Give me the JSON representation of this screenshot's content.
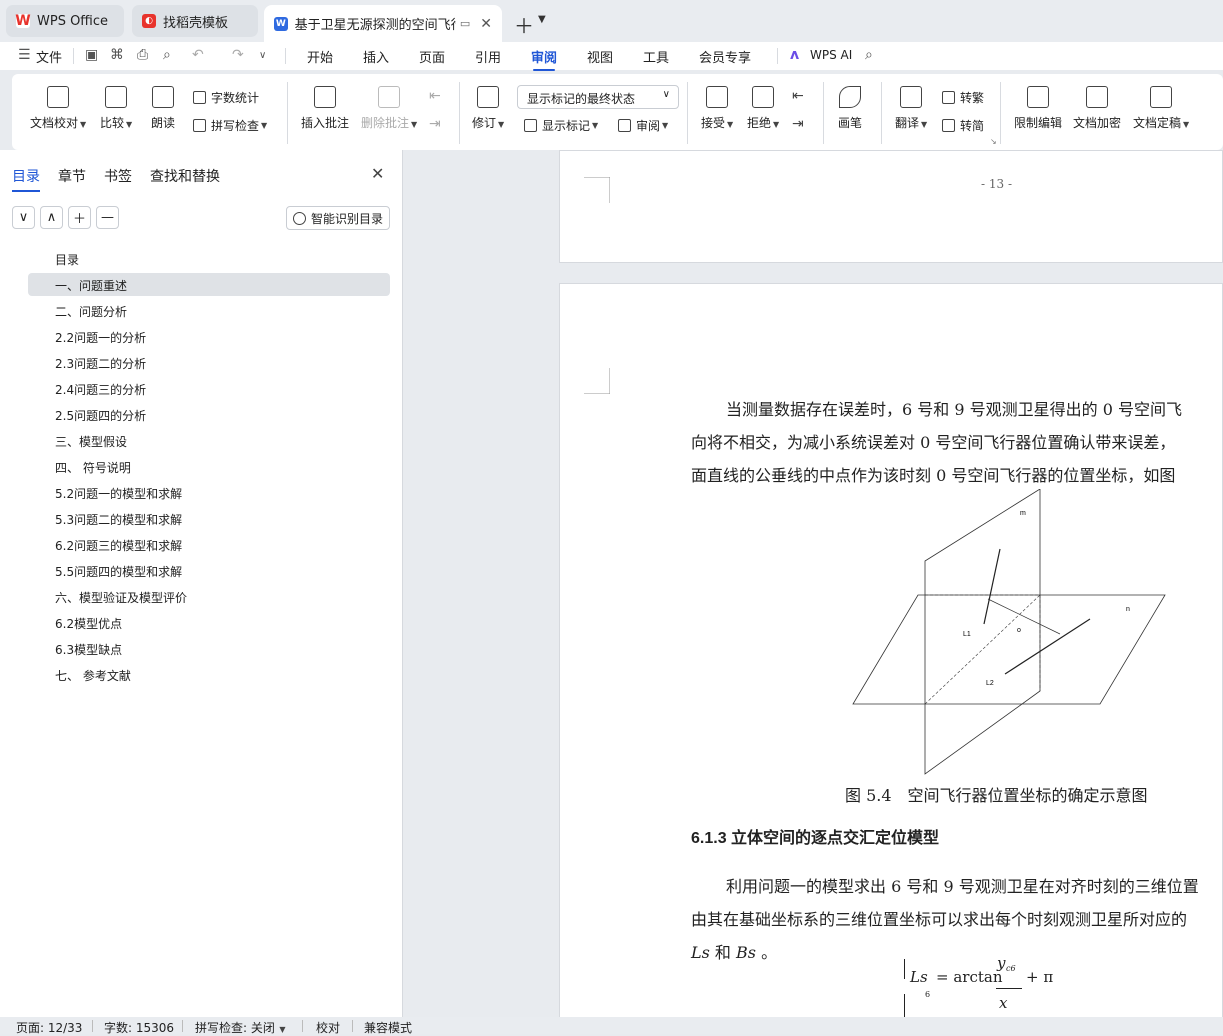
{
  "tabs": [
    {
      "label": "WPS Office",
      "icon": "wps-logo-icon"
    },
    {
      "label": "找稻壳模板",
      "icon": "docer-icon"
    },
    {
      "label": "基于卫星无源探测的空间飞行器",
      "icon": "word-doc-icon"
    }
  ],
  "menu": {
    "file": "文件",
    "items": [
      "开始",
      "插入",
      "页面",
      "引用",
      "审阅",
      "视图",
      "工具",
      "会员专享"
    ],
    "active": "审阅",
    "ai": "WPS AI"
  },
  "ribbon": {
    "doc_proof": "文档校对",
    "compare": "比较",
    "read_aloud": "朗读",
    "word_count": "字数统计",
    "spell_check": "拼写检查",
    "insert_comment": "插入批注",
    "delete_comment": "删除批注",
    "revise": "修订",
    "markup_state": "显示标记的最终状态",
    "show_markup": "显示标记",
    "review": "审阅",
    "accept": "接受",
    "reject": "拒绝",
    "pen": "画笔",
    "translate": "翻译",
    "to_traditional": "转繁",
    "to_simplified": "转简",
    "restrict_edit": "限制编辑",
    "encrypt": "文档加密",
    "finalize": "文档定稿"
  },
  "sidebar": {
    "tabs": [
      "目录",
      "章节",
      "书签",
      "查找和替换"
    ],
    "smart_toc": "智能识别目录",
    "toc": [
      "目录",
      "一、问题重述",
      "二、问题分析",
      "2.2问题一的分析",
      "2.3问题二的分析",
      "2.4问题三的分析",
      "2.5问题四的分析",
      "三、模型假设",
      "四、 符号说明",
      "5.2问题一的模型和求解",
      "5.3问题二的模型和求解",
      "6.2问题三的模型和求解",
      "5.5问题四的模型和求解",
      "六、模型验证及模型评价",
      "6.2模型优点",
      "6.3模型缺点",
      "七、 参考文献"
    ]
  },
  "document": {
    "page_number": "- 13 -",
    "para1": [
      "当测量数据存在误差时，6 号和 9 号观测卫星得出的 0 号空间飞",
      "向将不相交，为减小系统误差对 0 号空间飞行器位置确认带来误差，",
      "面直线的公垂线的中点作为该时刻 0 号空间飞行器的位置坐标，如图"
    ],
    "figure_labels": {
      "m": "m",
      "n": "n",
      "L1": "L1",
      "L2": "L2",
      "o": "o"
    },
    "caption": "图 5.4　空间飞行器位置坐标的确定示意图",
    "heading": "6.1.3 立体空间的逐点交汇定位模型",
    "para2": [
      "利用问题一的模型求出 6 号和 9 号观测卫星在对齐时刻的三维位置",
      "由其在基础坐标系的三维位置坐标可以求出每个时刻观测卫星所对应的"
    ],
    "para2_end_a": "Ls",
    "para2_end_mid": " 和 ",
    "para2_end_b": "Bs",
    "para2_end_tail": " 。",
    "formula": {
      "lhs": "Ls",
      "eq": "= arctan",
      "num": "y",
      "num_sub": "c6",
      "tail": "+ π",
      "den": "x",
      "side_index": "6"
    }
  },
  "status": {
    "page": "页面: 12/33",
    "words": "字数: 15306",
    "spell": "拼写检查: 关闭",
    "proof": "校对",
    "compat": "兼容模式"
  }
}
